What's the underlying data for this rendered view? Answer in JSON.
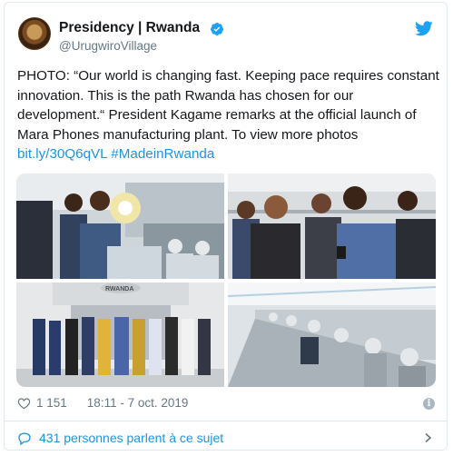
{
  "account": {
    "name": "Presidency | Rwanda",
    "handle": "@UrugwiroVillage"
  },
  "tweet": {
    "text": "PHOTO: “Our world is changing fast. Keeping pace requires constant innovation. This is the path Rwanda has chosen for our development.“ President Kagame remarks at the official launch of Mara Phones manufacturing plant. To view more photos",
    "link": "bit.ly/30Q6qVL",
    "hashtag": "#MadeinRwanda",
    "photo_sign": "RWANDA"
  },
  "footer": {
    "likes": "1 151",
    "timestamp": "18:11 - 7 oct. 2019",
    "info_glyph": "i",
    "conversation": "431 personnes parlent à ce sujet"
  },
  "icons": [
    "verified-badge-icon",
    "twitter-bird-icon",
    "heart-icon",
    "info-icon",
    "comment-icon",
    "chevron-right-icon"
  ],
  "colors": {
    "link": "#1b95e0",
    "muted": "#657786",
    "verified": "#1da1f2"
  }
}
